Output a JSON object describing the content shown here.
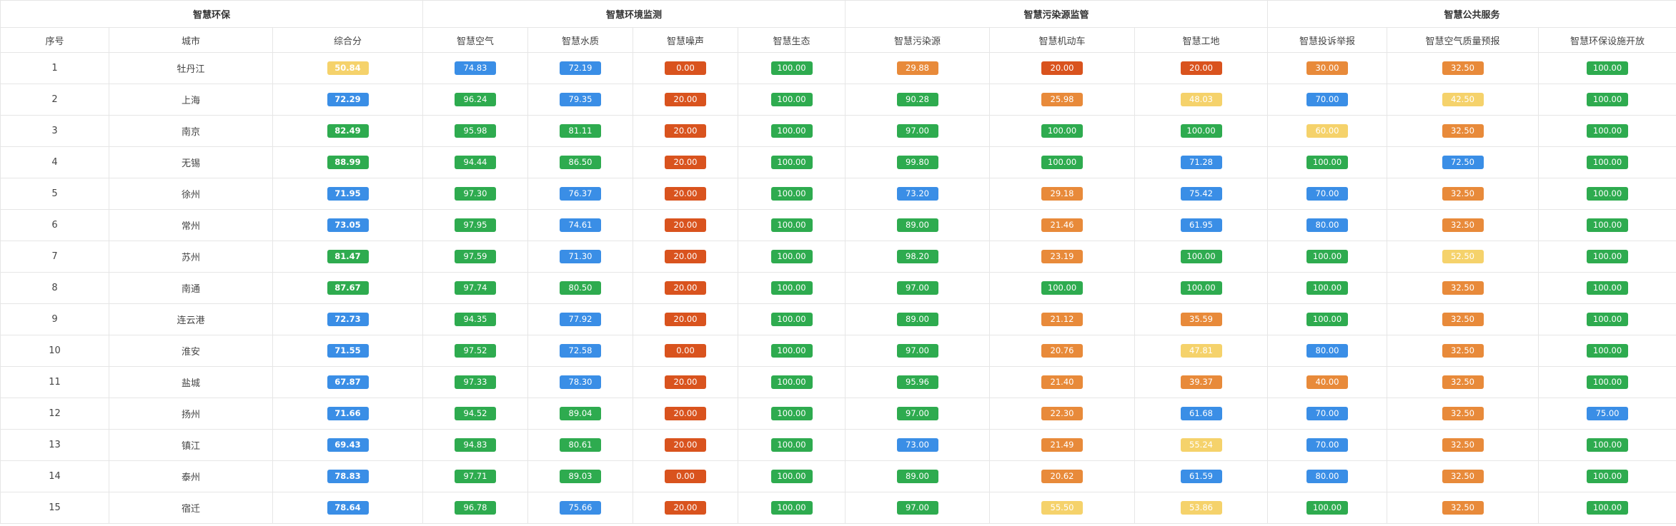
{
  "header_groups": [
    {
      "label": "智慧环保",
      "span": 3
    },
    {
      "label": "智慧环境监测",
      "span": 4
    },
    {
      "label": "智慧污染源监管",
      "span": 3
    },
    {
      "label": "智慧公共服务",
      "span": 3
    }
  ],
  "columns": [
    "序号",
    "城市",
    "综合分",
    "智慧空气",
    "智慧水质",
    "智慧噪声",
    "智慧生态",
    "智慧污染源",
    "智慧机动车",
    "智慧工地",
    "智慧投诉举报",
    "智慧空气质量预报",
    "智慧环保设施开放"
  ],
  "colors": {
    "green": "#2eab4f",
    "blue": "#3a8ee6",
    "orange": "#e88a3a",
    "red": "#d9531e",
    "yellow": "#f5d26b"
  },
  "rows": [
    {
      "index": "1",
      "city": "牡丹江",
      "cells": [
        {
          "v": "50.84",
          "c": "yellow"
        },
        {
          "v": "74.83",
          "c": "blue"
        },
        {
          "v": "72.19",
          "c": "blue"
        },
        {
          "v": "0.00",
          "c": "red"
        },
        {
          "v": "100.00",
          "c": "green"
        },
        {
          "v": "29.88",
          "c": "orange"
        },
        {
          "v": "20.00",
          "c": "red"
        },
        {
          "v": "20.00",
          "c": "red"
        },
        {
          "v": "30.00",
          "c": "orange"
        },
        {
          "v": "32.50",
          "c": "orange"
        },
        {
          "v": "100.00",
          "c": "green"
        }
      ]
    },
    {
      "index": "2",
      "city": "上海",
      "cells": [
        {
          "v": "72.29",
          "c": "blue"
        },
        {
          "v": "96.24",
          "c": "green"
        },
        {
          "v": "79.35",
          "c": "blue"
        },
        {
          "v": "20.00",
          "c": "red"
        },
        {
          "v": "100.00",
          "c": "green"
        },
        {
          "v": "90.28",
          "c": "green"
        },
        {
          "v": "25.98",
          "c": "orange"
        },
        {
          "v": "48.03",
          "c": "yellow"
        },
        {
          "v": "70.00",
          "c": "blue"
        },
        {
          "v": "42.50",
          "c": "yellow"
        },
        {
          "v": "100.00",
          "c": "green"
        }
      ]
    },
    {
      "index": "3",
      "city": "南京",
      "cells": [
        {
          "v": "82.49",
          "c": "green"
        },
        {
          "v": "95.98",
          "c": "green"
        },
        {
          "v": "81.11",
          "c": "green"
        },
        {
          "v": "20.00",
          "c": "red"
        },
        {
          "v": "100.00",
          "c": "green"
        },
        {
          "v": "97.00",
          "c": "green"
        },
        {
          "v": "100.00",
          "c": "green"
        },
        {
          "v": "100.00",
          "c": "green"
        },
        {
          "v": "60.00",
          "c": "yellow"
        },
        {
          "v": "32.50",
          "c": "orange"
        },
        {
          "v": "100.00",
          "c": "green"
        }
      ]
    },
    {
      "index": "4",
      "city": "无锡",
      "cells": [
        {
          "v": "88.99",
          "c": "green"
        },
        {
          "v": "94.44",
          "c": "green"
        },
        {
          "v": "86.50",
          "c": "green"
        },
        {
          "v": "20.00",
          "c": "red"
        },
        {
          "v": "100.00",
          "c": "green"
        },
        {
          "v": "99.80",
          "c": "green"
        },
        {
          "v": "100.00",
          "c": "green"
        },
        {
          "v": "71.28",
          "c": "blue"
        },
        {
          "v": "100.00",
          "c": "green"
        },
        {
          "v": "72.50",
          "c": "blue"
        },
        {
          "v": "100.00",
          "c": "green"
        }
      ]
    },
    {
      "index": "5",
      "city": "徐州",
      "cells": [
        {
          "v": "71.95",
          "c": "blue"
        },
        {
          "v": "97.30",
          "c": "green"
        },
        {
          "v": "76.37",
          "c": "blue"
        },
        {
          "v": "20.00",
          "c": "red"
        },
        {
          "v": "100.00",
          "c": "green"
        },
        {
          "v": "73.20",
          "c": "blue"
        },
        {
          "v": "29.18",
          "c": "orange"
        },
        {
          "v": "75.42",
          "c": "blue"
        },
        {
          "v": "70.00",
          "c": "blue"
        },
        {
          "v": "32.50",
          "c": "orange"
        },
        {
          "v": "100.00",
          "c": "green"
        }
      ]
    },
    {
      "index": "6",
      "city": "常州",
      "cells": [
        {
          "v": "73.05",
          "c": "blue"
        },
        {
          "v": "97.95",
          "c": "green"
        },
        {
          "v": "74.61",
          "c": "blue"
        },
        {
          "v": "20.00",
          "c": "red"
        },
        {
          "v": "100.00",
          "c": "green"
        },
        {
          "v": "89.00",
          "c": "green"
        },
        {
          "v": "21.46",
          "c": "orange"
        },
        {
          "v": "61.95",
          "c": "blue"
        },
        {
          "v": "80.00",
          "c": "blue"
        },
        {
          "v": "32.50",
          "c": "orange"
        },
        {
          "v": "100.00",
          "c": "green"
        }
      ]
    },
    {
      "index": "7",
      "city": "苏州",
      "cells": [
        {
          "v": "81.47",
          "c": "green"
        },
        {
          "v": "97.59",
          "c": "green"
        },
        {
          "v": "71.30",
          "c": "blue"
        },
        {
          "v": "20.00",
          "c": "red"
        },
        {
          "v": "100.00",
          "c": "green"
        },
        {
          "v": "98.20",
          "c": "green"
        },
        {
          "v": "23.19",
          "c": "orange"
        },
        {
          "v": "100.00",
          "c": "green"
        },
        {
          "v": "100.00",
          "c": "green"
        },
        {
          "v": "52.50",
          "c": "yellow"
        },
        {
          "v": "100.00",
          "c": "green"
        }
      ]
    },
    {
      "index": "8",
      "city": "南通",
      "cells": [
        {
          "v": "87.67",
          "c": "green"
        },
        {
          "v": "97.74",
          "c": "green"
        },
        {
          "v": "80.50",
          "c": "green"
        },
        {
          "v": "20.00",
          "c": "red"
        },
        {
          "v": "100.00",
          "c": "green"
        },
        {
          "v": "97.00",
          "c": "green"
        },
        {
          "v": "100.00",
          "c": "green"
        },
        {
          "v": "100.00",
          "c": "green"
        },
        {
          "v": "100.00",
          "c": "green"
        },
        {
          "v": "32.50",
          "c": "orange"
        },
        {
          "v": "100.00",
          "c": "green"
        }
      ]
    },
    {
      "index": "9",
      "city": "连云港",
      "cells": [
        {
          "v": "72.73",
          "c": "blue"
        },
        {
          "v": "94.35",
          "c": "green"
        },
        {
          "v": "77.92",
          "c": "blue"
        },
        {
          "v": "20.00",
          "c": "red"
        },
        {
          "v": "100.00",
          "c": "green"
        },
        {
          "v": "89.00",
          "c": "green"
        },
        {
          "v": "21.12",
          "c": "orange"
        },
        {
          "v": "35.59",
          "c": "orange"
        },
        {
          "v": "100.00",
          "c": "green"
        },
        {
          "v": "32.50",
          "c": "orange"
        },
        {
          "v": "100.00",
          "c": "green"
        }
      ]
    },
    {
      "index": "10",
      "city": "淮安",
      "cells": [
        {
          "v": "71.55",
          "c": "blue"
        },
        {
          "v": "97.52",
          "c": "green"
        },
        {
          "v": "72.58",
          "c": "blue"
        },
        {
          "v": "0.00",
          "c": "red"
        },
        {
          "v": "100.00",
          "c": "green"
        },
        {
          "v": "97.00",
          "c": "green"
        },
        {
          "v": "20.76",
          "c": "orange"
        },
        {
          "v": "47.81",
          "c": "yellow"
        },
        {
          "v": "80.00",
          "c": "blue"
        },
        {
          "v": "32.50",
          "c": "orange"
        },
        {
          "v": "100.00",
          "c": "green"
        }
      ]
    },
    {
      "index": "11",
      "city": "盐城",
      "cells": [
        {
          "v": "67.87",
          "c": "blue"
        },
        {
          "v": "97.33",
          "c": "green"
        },
        {
          "v": "78.30",
          "c": "blue"
        },
        {
          "v": "20.00",
          "c": "red"
        },
        {
          "v": "100.00",
          "c": "green"
        },
        {
          "v": "95.96",
          "c": "green"
        },
        {
          "v": "21.40",
          "c": "orange"
        },
        {
          "v": "39.37",
          "c": "orange"
        },
        {
          "v": "40.00",
          "c": "orange"
        },
        {
          "v": "32.50",
          "c": "orange"
        },
        {
          "v": "100.00",
          "c": "green"
        }
      ]
    },
    {
      "index": "12",
      "city": "扬州",
      "cells": [
        {
          "v": "71.66",
          "c": "blue"
        },
        {
          "v": "94.52",
          "c": "green"
        },
        {
          "v": "89.04",
          "c": "green"
        },
        {
          "v": "20.00",
          "c": "red"
        },
        {
          "v": "100.00",
          "c": "green"
        },
        {
          "v": "97.00",
          "c": "green"
        },
        {
          "v": "22.30",
          "c": "orange"
        },
        {
          "v": "61.68",
          "c": "blue"
        },
        {
          "v": "70.00",
          "c": "blue"
        },
        {
          "v": "32.50",
          "c": "orange"
        },
        {
          "v": "75.00",
          "c": "blue"
        }
      ]
    },
    {
      "index": "13",
      "city": "镇江",
      "cells": [
        {
          "v": "69.43",
          "c": "blue"
        },
        {
          "v": "94.83",
          "c": "green"
        },
        {
          "v": "80.61",
          "c": "green"
        },
        {
          "v": "20.00",
          "c": "red"
        },
        {
          "v": "100.00",
          "c": "green"
        },
        {
          "v": "73.00",
          "c": "blue"
        },
        {
          "v": "21.49",
          "c": "orange"
        },
        {
          "v": "55.24",
          "c": "yellow"
        },
        {
          "v": "70.00",
          "c": "blue"
        },
        {
          "v": "32.50",
          "c": "orange"
        },
        {
          "v": "100.00",
          "c": "green"
        }
      ]
    },
    {
      "index": "14",
      "city": "泰州",
      "cells": [
        {
          "v": "78.83",
          "c": "blue"
        },
        {
          "v": "97.71",
          "c": "green"
        },
        {
          "v": "89.03",
          "c": "green"
        },
        {
          "v": "0.00",
          "c": "red"
        },
        {
          "v": "100.00",
          "c": "green"
        },
        {
          "v": "89.00",
          "c": "green"
        },
        {
          "v": "20.62",
          "c": "orange"
        },
        {
          "v": "61.59",
          "c": "blue"
        },
        {
          "v": "80.00",
          "c": "blue"
        },
        {
          "v": "32.50",
          "c": "orange"
        },
        {
          "v": "100.00",
          "c": "green"
        }
      ]
    },
    {
      "index": "15",
      "city": "宿迁",
      "cells": [
        {
          "v": "78.64",
          "c": "blue"
        },
        {
          "v": "96.78",
          "c": "green"
        },
        {
          "v": "75.66",
          "c": "blue"
        },
        {
          "v": "20.00",
          "c": "red"
        },
        {
          "v": "100.00",
          "c": "green"
        },
        {
          "v": "97.00",
          "c": "green"
        },
        {
          "v": "55.50",
          "c": "yellow"
        },
        {
          "v": "53.86",
          "c": "yellow"
        },
        {
          "v": "100.00",
          "c": "green"
        },
        {
          "v": "32.50",
          "c": "orange"
        },
        {
          "v": "100.00",
          "c": "green"
        }
      ]
    }
  ]
}
